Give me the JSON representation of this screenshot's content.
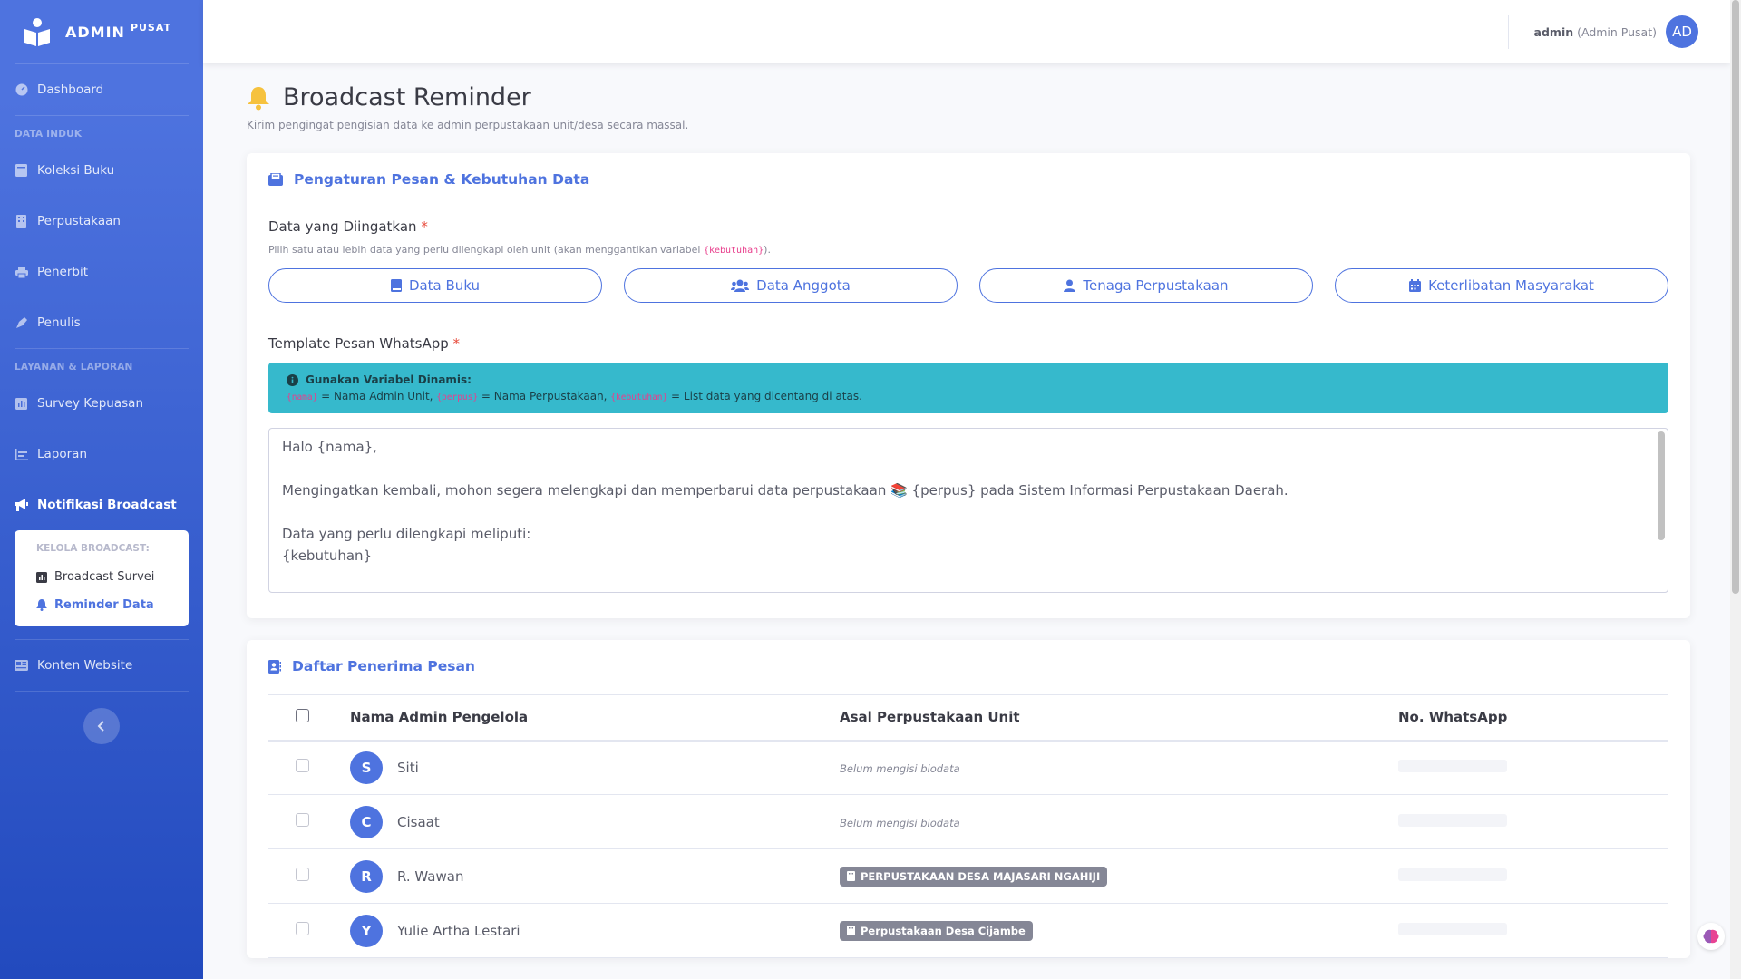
{
  "brand": {
    "name": "ADMIN",
    "sup": "PUSAT"
  },
  "sidebar": {
    "dashboard": "Dashboard",
    "heading_data": "DATA INDUK",
    "koleksi": "Koleksi Buku",
    "perpustakaan": "Perpustakaan",
    "penerbit": "Penerbit",
    "penulis": "Penulis",
    "heading_layanan": "LAYANAN & LAPORAN",
    "survey": "Survey Kepuasan",
    "laporan": "Laporan",
    "notifikasi": "Notifikasi Broadcast",
    "collapse_header": "KELOLA BROADCAST:",
    "broadcast_survei": "Broadcast Survei",
    "reminder_data": "Reminder Data",
    "konten": "Konten Website"
  },
  "topbar": {
    "user": "admin",
    "role": "(Admin Pusat)",
    "avatar": "AD"
  },
  "page": {
    "title": "Broadcast Reminder",
    "subtitle": "Kirim pengingat pengisian data ke admin perpustakaan unit/desa secara massal."
  },
  "settings_card": {
    "title": "Pengaturan Pesan & Kebutuhan Data",
    "data_label": "Data yang Diingatkan",
    "data_hint_pre": "Pilih satu atau lebih data yang perlu dilengkapi oleh unit (akan menggantikan variabel ",
    "data_hint_code": "{kebutuhan}",
    "data_hint_post": ").",
    "options": [
      "Data Buku",
      "Data Anggota",
      "Tenaga Perpustakaan",
      "Keterlibatan Masyarakat"
    ],
    "template_label": "Template Pesan WhatsApp",
    "alert_title": "Gunakan Variabel Dinamis:",
    "var_nama": "{nama}",
    "var_nama_desc": " = Nama Admin Unit, ",
    "var_perpus": "{perpus}",
    "var_perpus_desc": " = Nama Perpustakaan, ",
    "var_kebutuhan": "{kebutuhan}",
    "var_kebutuhan_desc": " = List data yang dicentang di atas.",
    "message_lines": [
      "Halo {nama},",
      "",
      "Mengingatkan kembali, mohon segera melengkapi dan memperbarui data perpustakaan 📚 {perpus} pada Sistem Informasi Perpustakaan Daerah.",
      "",
      "Data yang perlu dilengkapi meliputi:",
      "{kebutuhan}"
    ]
  },
  "recipients_card": {
    "title": "Daftar Penerima Pesan",
    "columns": [
      "Nama Admin Pengelola",
      "Asal Perpustakaan Unit",
      "No. WhatsApp"
    ],
    "rows": [
      {
        "initial": "S",
        "name": "Siti",
        "unit": "Belum mengisi biodata",
        "unit_type": "empty"
      },
      {
        "initial": "C",
        "name": "Cisaat",
        "unit": "Belum mengisi biodata",
        "unit_type": "empty"
      },
      {
        "initial": "R",
        "name": "R. Wawan",
        "unit": "PERPUSTAKAAN DESA MAJASARI NGAHIJI",
        "unit_type": "badge"
      },
      {
        "initial": "Y",
        "name": "Yulie Artha Lestari",
        "unit": "Perpustakaan Desa Cijambe",
        "unit_type": "badge"
      }
    ]
  },
  "colors": {
    "primary": "#4e73df",
    "info": "#36b9cc",
    "secondary": "#858796",
    "danger": "#e74a3b"
  }
}
